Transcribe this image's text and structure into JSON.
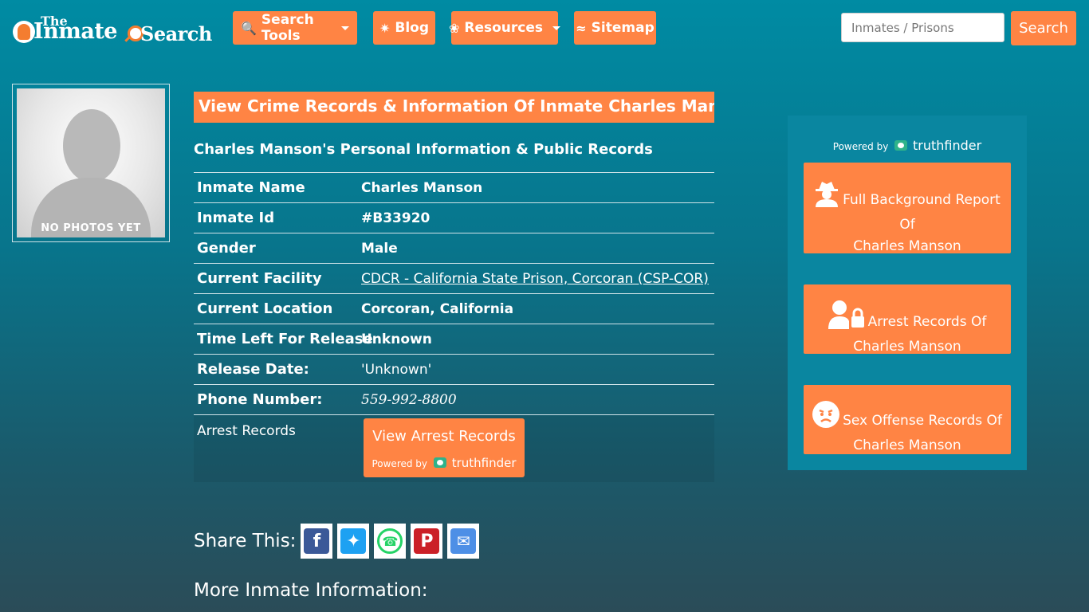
{
  "header": {
    "logo": {
      "the": "The",
      "inmate": "Inmate",
      "search": "Search"
    },
    "nav": [
      {
        "label": "Search Tools",
        "icon": "search-magnifier-icon",
        "dropdown": true
      },
      {
        "label": "Blog",
        "icon": "blog-icon",
        "dropdown": false
      },
      {
        "label": "Resources",
        "icon": "leaf-icon",
        "dropdown": true
      },
      {
        "label": "Sitemap",
        "icon": "rss-icon",
        "dropdown": false
      }
    ],
    "search_placeholder": "Inmates / Prisons",
    "search_button": "Search"
  },
  "photo": {
    "label": "NO PHOTOS YET"
  },
  "main": {
    "title": "View Crime Records & Information Of Inmate Charles Manson",
    "subheading": "Charles Manson's Personal Information & Public Records",
    "rows": [
      {
        "label": "Inmate Name",
        "value": "Charles Manson"
      },
      {
        "label": "Inmate Id",
        "value": "#B33920"
      },
      {
        "label": "Gender",
        "value": "Male"
      },
      {
        "label": "Current Facility",
        "value": "CDCR - California State Prison, Corcoran (CSP-COR)"
      },
      {
        "label": "Current Location",
        "value": "Corcoran, California"
      },
      {
        "label": "Time Left For Release",
        "value": "Unknown"
      },
      {
        "label": "Release Date:",
        "value": "'Unknown'"
      },
      {
        "label": "Phone Number:",
        "value": "559-992-8800"
      }
    ],
    "arrest": {
      "label": "Arrest Records",
      "button": "View Arrest Records",
      "powered_by": "Powered by",
      "brand": "truthfinder"
    },
    "share_label": "Share This:",
    "more_info": "More Inmate Information:"
  },
  "sidebar": {
    "powered_by": "Powered by",
    "brand": "truthfinder",
    "buttons": [
      {
        "line1": "Full Background Report",
        "line2": "Of",
        "line3": "Charles Manson",
        "icon": "spy-icon"
      },
      {
        "line1": "Arrest Records Of",
        "line2": "Charles Manson",
        "icon": "user-lock-icon"
      },
      {
        "line1": "Sex Offense Records Of",
        "line2": "Charles Manson",
        "icon": "angry-face-icon"
      }
    ]
  },
  "colors": {
    "accent": "#ff8444",
    "background": "#008ba3",
    "facebook": "#3b5998",
    "twitter": "#1da1f2",
    "whatsapp": "#25d366",
    "pinterest": "#cb2027",
    "email": "#4d8fe6"
  }
}
